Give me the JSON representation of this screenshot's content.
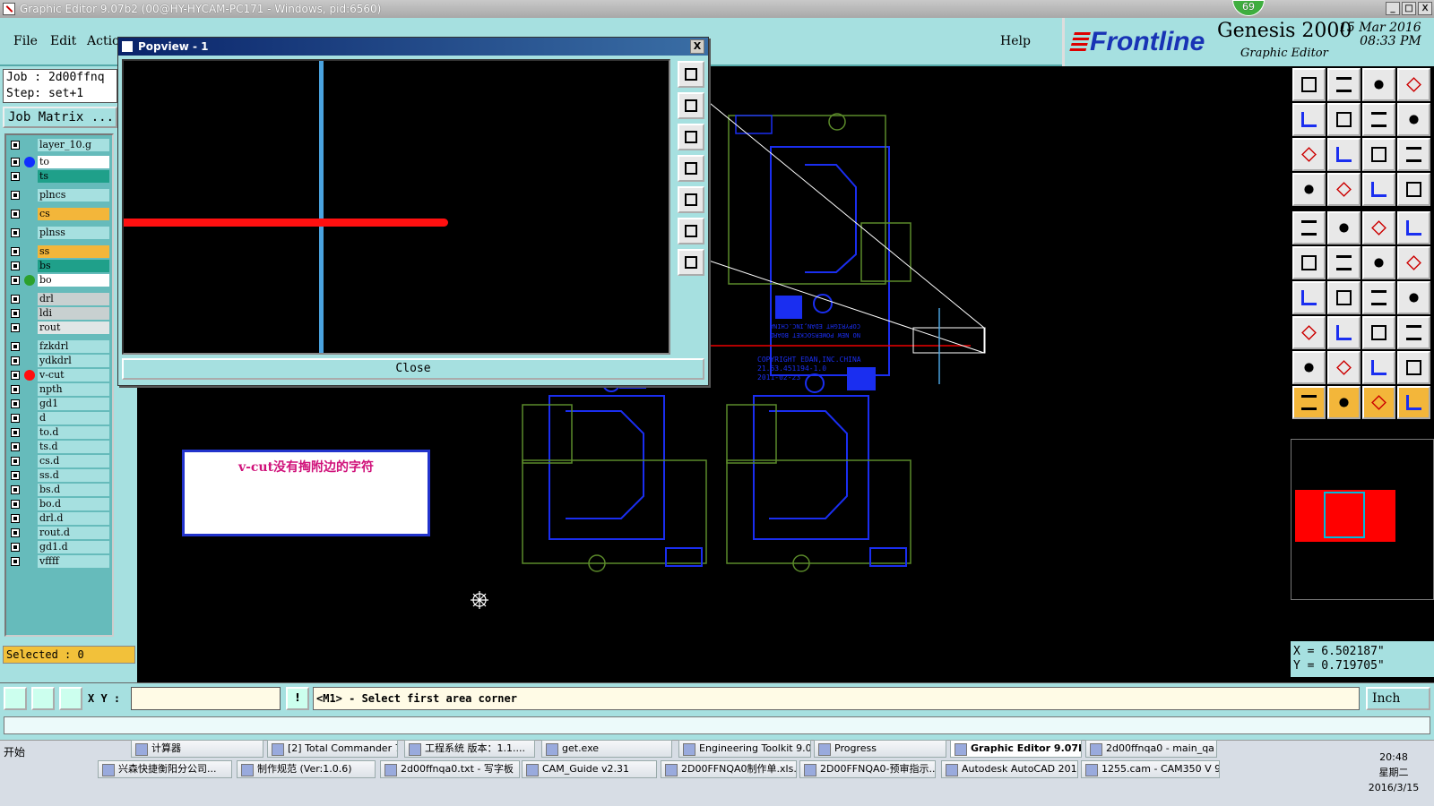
{
  "window": {
    "title": "Graphic Editor 9.07b2 (00@HY-HYCAM-PC171 - Windows, pid:6560)",
    "badge": "69",
    "controls": [
      "_",
      "□",
      "X"
    ]
  },
  "menu": {
    "items": [
      "File",
      "Edit",
      "Actio"
    ],
    "help": "Help"
  },
  "brand": {
    "frontline": "Frontline",
    "product": "Genesis 2000",
    "subtitle": "Graphic Editor",
    "date": "15 Mar 2016",
    "time": "08:33 PM"
  },
  "job": {
    "job_line": "Job : 2d00ffnq",
    "step_line": "Step: set+1",
    "matrix_label": "Job Matrix ..."
  },
  "layers": [
    {
      "name": "layer_10.g",
      "bg": "#a6e0e0",
      "dot": ""
    },
    {
      "name": "to",
      "bg": "#ffffff",
      "dot": "#1030ff"
    },
    {
      "name": "ts",
      "bg": "#1fa08a",
      "dot": ""
    },
    {
      "name": "plncs",
      "bg": "#a6e0e0",
      "dot": ""
    },
    {
      "name": "cs",
      "bg": "#f3b63a",
      "dot": ""
    },
    {
      "name": "plnss",
      "bg": "#a6e0e0",
      "dot": ""
    },
    {
      "name": "ss",
      "bg": "#f3b63a",
      "dot": ""
    },
    {
      "name": "bs",
      "bg": "#1fa08a",
      "dot": ""
    },
    {
      "name": "bo",
      "bg": "#ffffff",
      "dot": "#2ca02c"
    },
    {
      "name": "drl",
      "bg": "#c8d0d0",
      "dot": ""
    },
    {
      "name": "ldi",
      "bg": "#c8d0d0",
      "dot": ""
    },
    {
      "name": "rout",
      "bg": "#e0e6e6",
      "dot": ""
    },
    {
      "name": "fzkdrl",
      "bg": "#a6e0e0",
      "dot": ""
    },
    {
      "name": "ydkdrl",
      "bg": "#a6e0e0",
      "dot": ""
    },
    {
      "name": "v-cut",
      "bg": "#a6e0e0",
      "dot": "#ff1010"
    },
    {
      "name": "npth",
      "bg": "#a6e0e0",
      "dot": ""
    },
    {
      "name": "gd1",
      "bg": "#a6e0e0",
      "dot": ""
    },
    {
      "name": "d",
      "bg": "#a6e0e0",
      "dot": ""
    },
    {
      "name": "to.d",
      "bg": "#a6e0e0",
      "dot": ""
    },
    {
      "name": "ts.d",
      "bg": "#a6e0e0",
      "dot": ""
    },
    {
      "name": "cs.d",
      "bg": "#a6e0e0",
      "dot": ""
    },
    {
      "name": "ss.d",
      "bg": "#a6e0e0",
      "dot": ""
    },
    {
      "name": "bs.d",
      "bg": "#a6e0e0",
      "dot": ""
    },
    {
      "name": "bo.d",
      "bg": "#a6e0e0",
      "dot": ""
    },
    {
      "name": "drl.d",
      "bg": "#a6e0e0",
      "dot": ""
    },
    {
      "name": "rout.d",
      "bg": "#a6e0e0",
      "dot": ""
    },
    {
      "name": "gd1.d",
      "bg": "#a6e0e0",
      "dot": ""
    },
    {
      "name": "vffff",
      "bg": "#a6e0e0",
      "dot": ""
    }
  ],
  "selected": "Selected : 0",
  "popview": {
    "title": "Popview - 1",
    "close_x": "X",
    "close_button": "Close"
  },
  "note": {
    "text": "v-cut没有掏附边的字符"
  },
  "canvas": {
    "board_texts": [
      "COPYRIGHT EDAN,INC.CHINA",
      "21.53.451194-1.0",
      "2011-02-23",
      "NO NEW POWERSOCKET BOARD",
      "COPYRIGHT EDAN,INC.CHINA"
    ]
  },
  "coords": {
    "x": "X = 6.502187\"",
    "y": "Y = 0.719705\""
  },
  "command": {
    "xy_label": "X Y :",
    "xy_value": "",
    "bang": "!",
    "prompt": "<M1> - Select first area corner",
    "unit": "Inch"
  },
  "taskbar": {
    "start": "开始",
    "row1": [
      {
        "label": "计算器"
      },
      {
        "label": "[2] Total Commander 7...."
      },
      {
        "label": "工程系统  版本：1.1...."
      },
      {
        "label": "get.exe"
      },
      {
        "label": "Engineering Toolkit 9.0..."
      },
      {
        "label": "Progress"
      },
      {
        "label": "Graphic Editor 9.07b...",
        "active": true
      },
      {
        "label": "2d00ffnqa0 - main_qa"
      }
    ],
    "row2": [
      {
        "label": "兴森快捷衡阳分公司..."
      },
      {
        "label": "制作规范 (Ver:1.0.6)"
      },
      {
        "label": "2d00ffnqa0.txt - 写字板"
      },
      {
        "label": "CAM_Guide v2.31"
      },
      {
        "label": "2D00FFNQA0制作单.xls..."
      },
      {
        "label": "2D00FFNQA0-预审指示..."
      },
      {
        "label": "Autodesk AutoCAD 201..."
      },
      {
        "label": "1255.cam - CAM350 V 9..."
      }
    ],
    "clock_time": "20:48",
    "clock_day": "星期二",
    "clock_date": "2016/3/15"
  }
}
